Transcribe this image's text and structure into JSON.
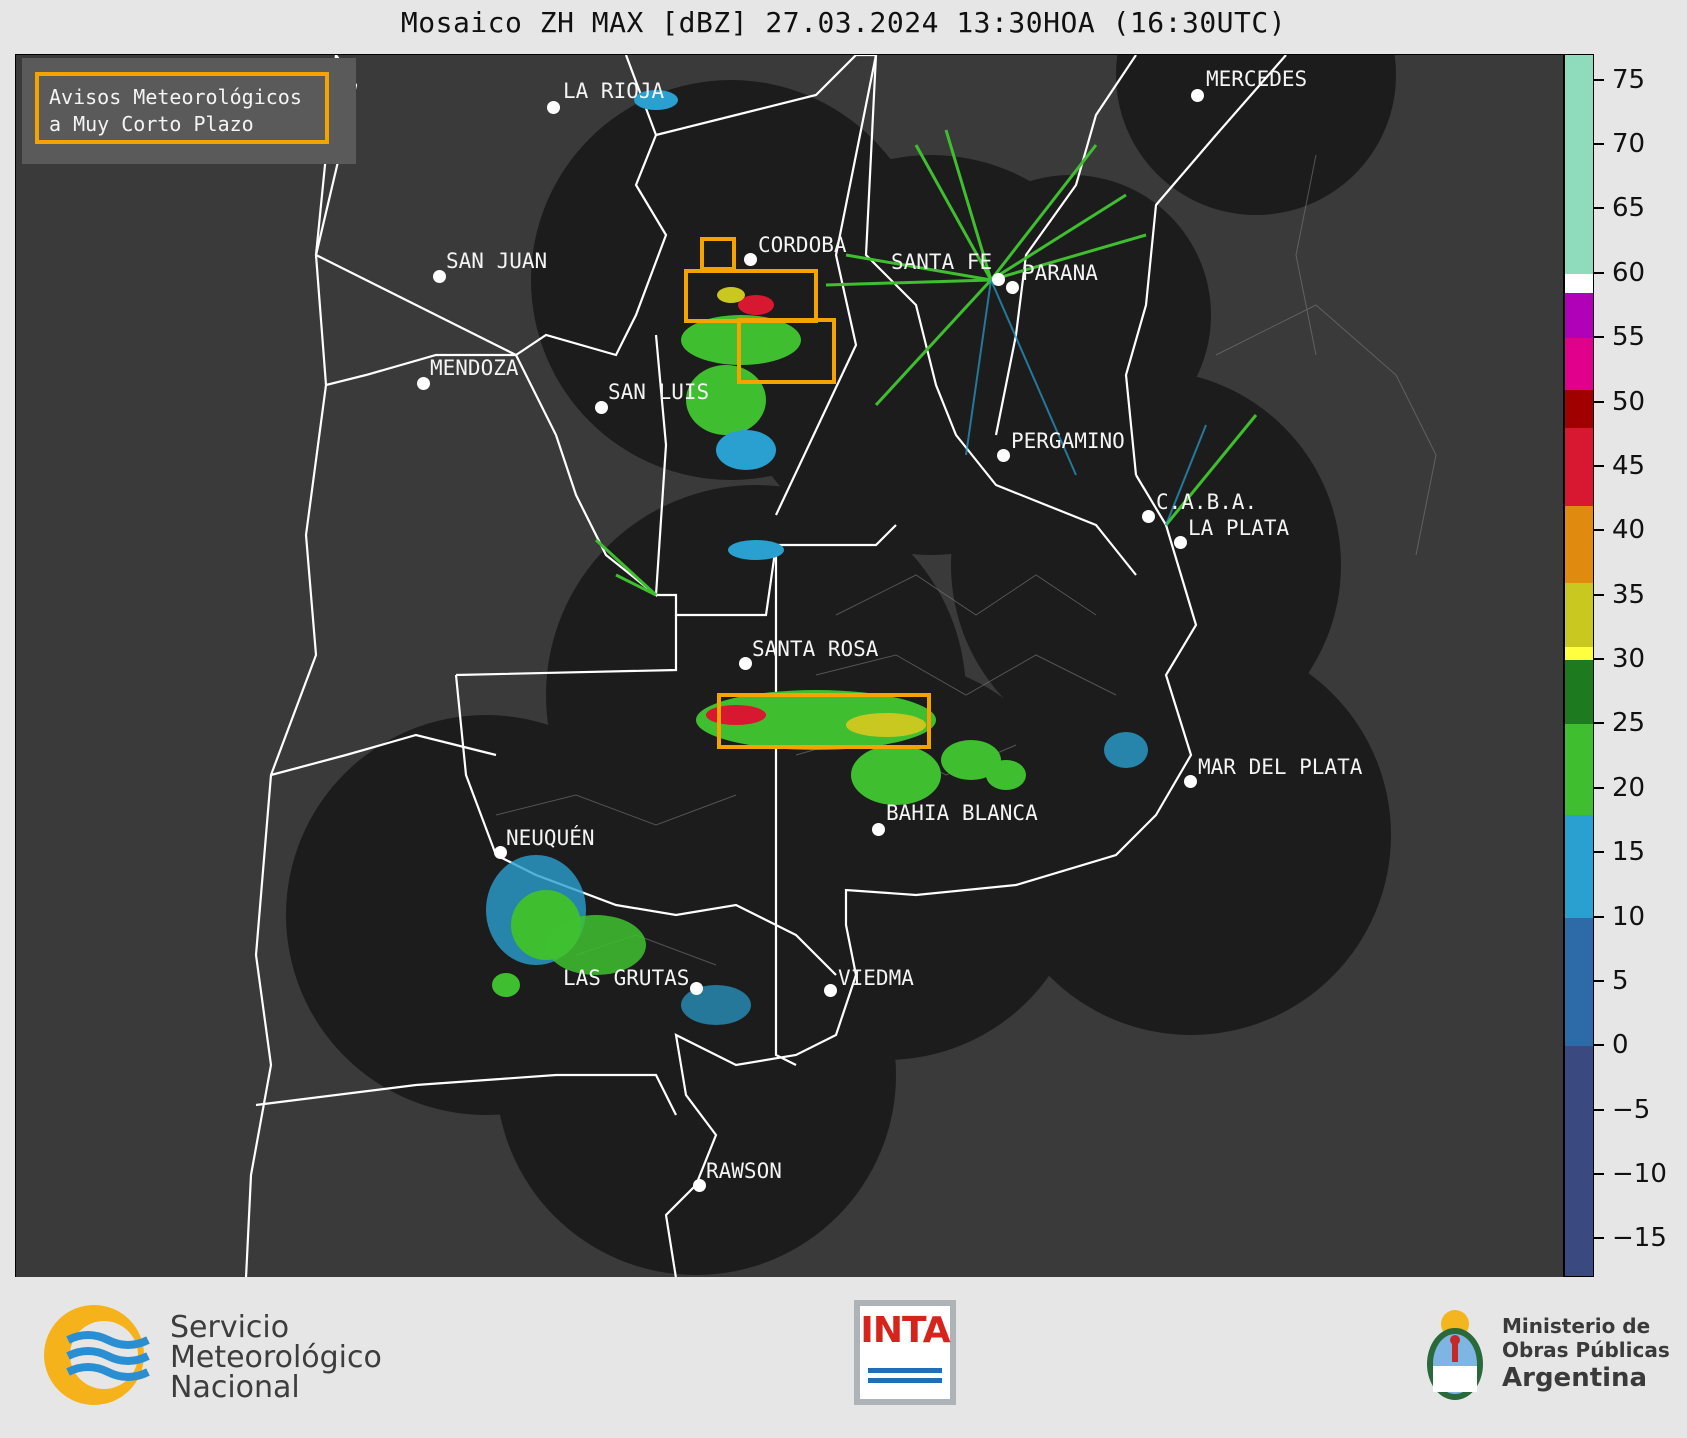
{
  "title": "Mosaico ZH MAX [dBZ] 27.03.2024 13:30HOA (16:30UTC)",
  "legend": {
    "line1": "Avisos Meteorológicos",
    "line2": "a Muy Corto Plazo",
    "color": "#f5a300"
  },
  "cities": [
    {
      "name": "LA RIOJA"
    },
    {
      "name": "MERCEDES"
    },
    {
      "name": "CORDOBA"
    },
    {
      "name": "SAN JUAN"
    },
    {
      "name": "SANTA FE"
    },
    {
      "name": "PARANA"
    },
    {
      "name": "MENDOZA"
    },
    {
      "name": "SAN LUIS"
    },
    {
      "name": "PERGAMINO"
    },
    {
      "name": "C.A.B.A."
    },
    {
      "name": "LA PLATA"
    },
    {
      "name": "SANTA ROSA"
    },
    {
      "name": "MAR DEL PLATA"
    },
    {
      "name": "BAHIA BLANCA"
    },
    {
      "name": "NEUQUÉN"
    },
    {
      "name": "LAS GRUTAS"
    },
    {
      "name": "VIEDMA"
    },
    {
      "name": "RAWSON"
    }
  ],
  "colorbar": {
    "min": -18,
    "max": 77,
    "ticks": [
      "75",
      "70",
      "65",
      "60",
      "55",
      "50",
      "45",
      "40",
      "35",
      "30",
      "25",
      "20",
      "15",
      "10",
      "5",
      "0",
      "−5",
      "−10",
      "−15"
    ],
    "tick_values": [
      75,
      70,
      65,
      60,
      55,
      50,
      45,
      40,
      35,
      30,
      25,
      20,
      15,
      10,
      5,
      0,
      -5,
      -10,
      -15
    ],
    "segments": [
      {
        "from": 60,
        "to": 77,
        "color": "#8fdcbc"
      },
      {
        "from": 58.5,
        "to": 60,
        "color": "#ffffff"
      },
      {
        "from": 55,
        "to": 58.5,
        "color": "#b000b8"
      },
      {
        "from": 51,
        "to": 55,
        "color": "#e0008c"
      },
      {
        "from": 48,
        "to": 51,
        "color": "#a00000"
      },
      {
        "from": 42,
        "to": 48,
        "color": "#d81830"
      },
      {
        "from": 36,
        "to": 42,
        "color": "#e08a10"
      },
      {
        "from": 31,
        "to": 36,
        "color": "#c8c820"
      },
      {
        "from": 30,
        "to": 31,
        "color": "#ffff40"
      },
      {
        "from": 25,
        "to": 30,
        "color": "#1e7a1e"
      },
      {
        "from": 18,
        "to": 25,
        "color": "#3fbf30"
      },
      {
        "from": 10,
        "to": 18,
        "color": "#2aa0d0"
      },
      {
        "from": 0,
        "to": 10,
        "color": "#2c6aa8"
      },
      {
        "from": -18,
        "to": 0,
        "color": "#3a4a80"
      }
    ]
  },
  "footer": {
    "smn_line1": "Servicio",
    "smn_line2": "Meteorológico",
    "smn_line3": "Nacional",
    "inta": "INTA",
    "ministry_line1": "Ministerio de",
    "ministry_line2": "Obras Públicas",
    "ministry_line3": "Argentina"
  }
}
